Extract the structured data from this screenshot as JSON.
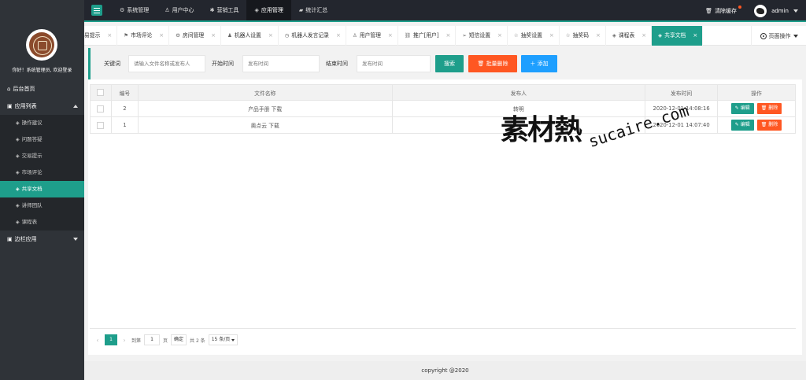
{
  "topbar": {
    "nav": [
      {
        "label": "系统管理",
        "icon": "gear-icon",
        "active": false
      },
      {
        "label": "用户中心",
        "icon": "user-icon",
        "active": false
      },
      {
        "label": "营销工具",
        "icon": "tools-icon",
        "active": false
      },
      {
        "label": "应用管理",
        "icon": "apps-icon",
        "active": true
      },
      {
        "label": "统计汇总",
        "icon": "chat-icon",
        "active": false
      }
    ],
    "clear_cache": "清除缓存",
    "username": "admin"
  },
  "sidebar": {
    "welcome": "你好！系统管理员, 欢迎登录",
    "home": "后台首页",
    "app_list": "应用列表",
    "sub_items": [
      {
        "label": "操作建议",
        "active": false
      },
      {
        "label": "问题答疑",
        "active": false
      },
      {
        "label": "交易提示",
        "active": false
      },
      {
        "label": "市场评论",
        "active": false
      },
      {
        "label": "共享文档",
        "active": true
      },
      {
        "label": "讲师团队",
        "active": false
      },
      {
        "label": "课程表",
        "active": false
      }
    ],
    "edge_app": "边栏应用"
  },
  "tabs": [
    {
      "label": "易提示",
      "icon": "",
      "active": false
    },
    {
      "label": "市场评论",
      "icon": "tag-icon",
      "active": false
    },
    {
      "label": "房间管理",
      "icon": "gear-icon",
      "active": false
    },
    {
      "label": "机器人设置",
      "icon": "user-icon",
      "active": false
    },
    {
      "label": "机器人发言记录",
      "icon": "clock-icon",
      "active": false
    },
    {
      "label": "用户管理",
      "icon": "user-icon",
      "active": false
    },
    {
      "label": "推广[用户]",
      "icon": "link-icon",
      "active": false
    },
    {
      "label": "短信设置",
      "icon": "send-icon",
      "active": false
    },
    {
      "label": "抽奖设置",
      "icon": "star-icon",
      "active": false
    },
    {
      "label": "抽奖码",
      "icon": "star-icon",
      "active": false
    },
    {
      "label": "课程表",
      "icon": "tag-icon",
      "active": false
    },
    {
      "label": "共享文档",
      "icon": "doc-icon",
      "active": true
    }
  ],
  "page_ops": "页面操作",
  "search": {
    "keyword_label": "关键词",
    "keyword_placeholder": "请输入文件名称或发布人",
    "start_label": "开始时间",
    "start_placeholder": "发布时间",
    "end_label": "结束时间",
    "end_placeholder": "发布时间",
    "search_btn": "搜索",
    "batch_delete_btn": "批量删除",
    "add_btn": "添加"
  },
  "table": {
    "headers": [
      "编号",
      "文件名称",
      "发布人",
      "发布时间",
      "操作"
    ],
    "rows": [
      {
        "id": "2",
        "name": "产品手册  下载",
        "publisher": "转明",
        "time": "2020-12-01 14:08:16"
      },
      {
        "id": "1",
        "name": "奥点云  下载",
        "publisher": "",
        "time": "2020-12-01 14:07:40"
      }
    ],
    "edit_label": "编辑",
    "delete_label": "删除"
  },
  "pager": {
    "current": "1",
    "goto_label": "到第",
    "goto_value": "1",
    "page_unit": "页",
    "confirm": "确定",
    "total": "共 2 条",
    "page_size": "15 条/页"
  },
  "footer": "copyright @2020",
  "watermark": {
    "cn": "素材熱",
    "en": "sucaire.com"
  },
  "colors": {
    "accent": "#1e9e8b",
    "danger": "#ff5722",
    "info": "#1e9fff",
    "topbar": "#23262e",
    "sidebar": "#2f3338"
  }
}
